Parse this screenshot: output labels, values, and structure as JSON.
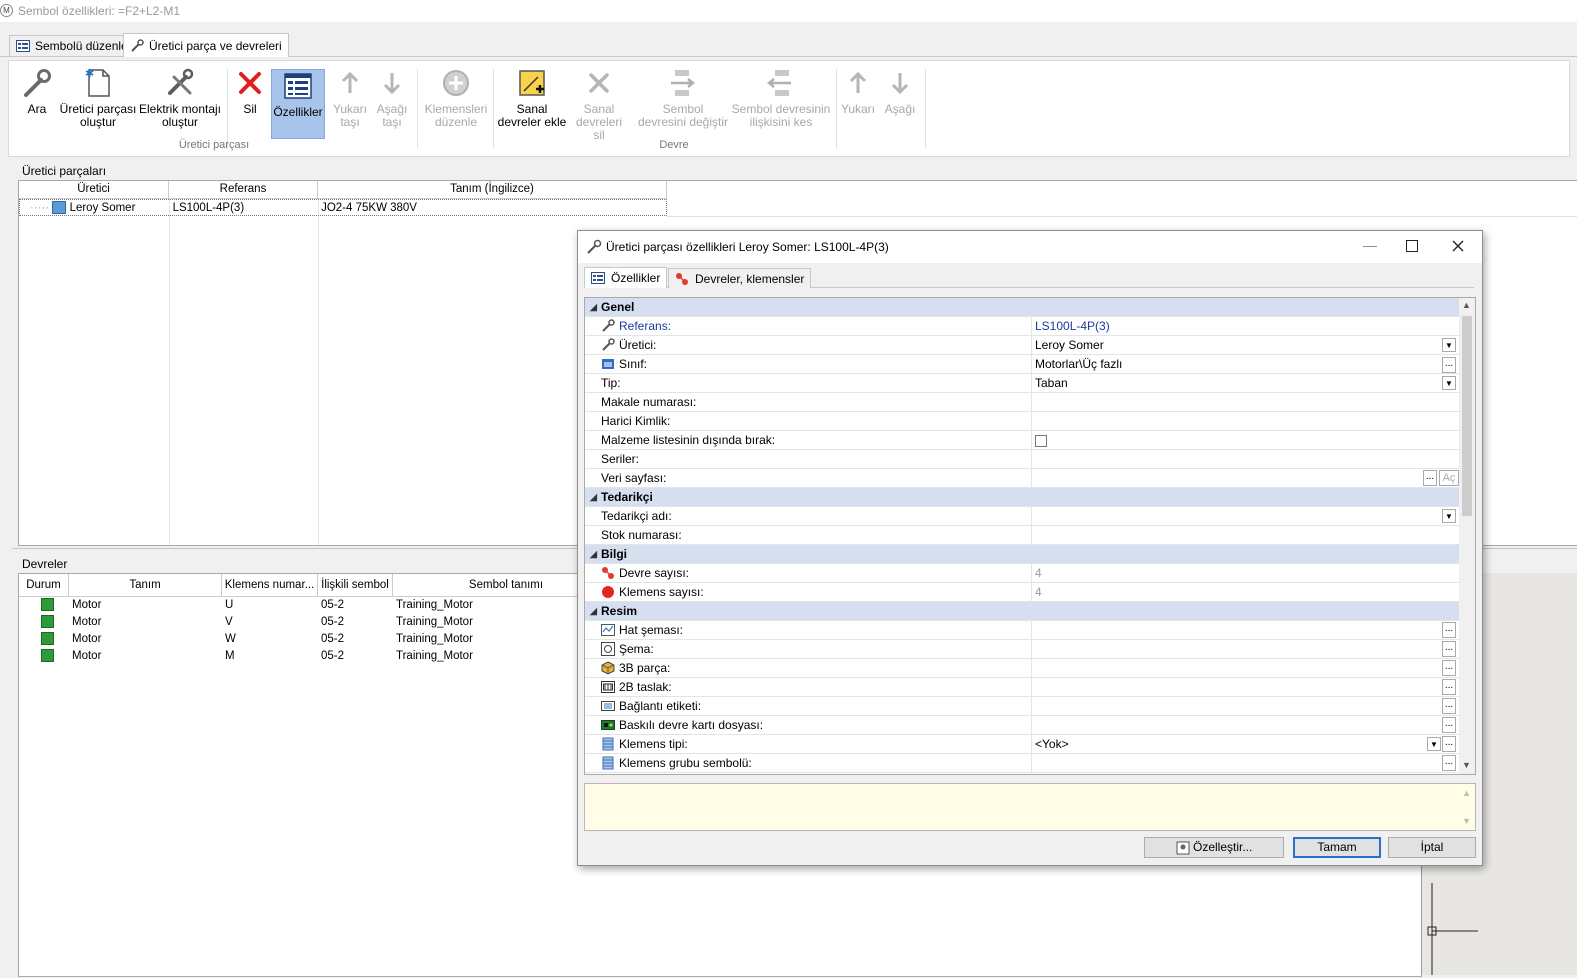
{
  "window": {
    "title": "Sembol özellikleri: =F2+L2-M1"
  },
  "tabs": [
    {
      "label": "Sembolü düzenle"
    },
    {
      "label": "Üretici parça ve devreleri"
    }
  ],
  "ribbon": {
    "ara": "Ara",
    "uretici_olustur": "Üretici parçası oluştur",
    "elektrik_olustur": "Elektrik montajı oluştur",
    "sil": "Sil",
    "ozellikler": "Özellikler",
    "yukari_tasi": "Yukarı taşı",
    "asagi_tasi": "Aşağı taşı",
    "group1": "Üretici parçası",
    "klemens_duzenle": "Klemensleri düzenle",
    "sanal_ekle": "Sanal devreler ekle",
    "sanal_sil": "Sanal devreleri sil",
    "sembol_degistir": "Sembol devresini değiştir",
    "sembol_kes": "Sembol devresinin ilişkisini kes",
    "yukari": "Yukarı",
    "asagi": "Aşağı",
    "group2": "Devre"
  },
  "mfr_section": {
    "title": "Üretici parçaları",
    "columns": [
      "Üretici",
      "Referans",
      "Tanım (İngilizce)"
    ],
    "rows": [
      {
        "uretici": "Leroy Somer",
        "referans": "LS100L-4P(3)",
        "tanim": "JO2-4  75KW  380V"
      }
    ]
  },
  "circuits_section": {
    "title": "Devreler",
    "columns": [
      "Durum",
      "Tanım",
      "Klemens numar...",
      "İlişkili sembol",
      "Sembol tanımı"
    ],
    "rows": [
      {
        "tanim": "Motor",
        "klemens": "U",
        "iliskili": "05-2",
        "sembol": "Training_Motor"
      },
      {
        "tanim": "Motor",
        "klemens": "V",
        "iliskili": "05-2",
        "sembol": "Training_Motor"
      },
      {
        "tanim": "Motor",
        "klemens": "W",
        "iliskili": "05-2",
        "sembol": "Training_Motor"
      },
      {
        "tanim": "Motor",
        "klemens": "M",
        "iliskili": "05-2",
        "sembol": "Training_Motor"
      }
    ]
  },
  "dialog": {
    "title": "Üretici parçası özellikleri Leroy Somer: LS100L-4P(3)",
    "tab1": "Özellikler",
    "tab2": "Devreler, klemensler",
    "cat_genel": "Genel",
    "cat_tedarikci": "Tedarikçi",
    "cat_bilgi": "Bilgi",
    "cat_resim": "Resim",
    "props": {
      "referans_lab": "Referans:",
      "referans_val": "LS100L-4P(3)",
      "uretici_lab": "Üretici:",
      "uretici_val": "Leroy Somer",
      "sinif_lab": "Sınıf:",
      "sinif_val": "Motorlar\\Üç fazlı",
      "tip_lab": "Tip:",
      "tip_val": "Taban",
      "makale_lab": "Makale numarası:",
      "harici_lab": "Harici Kimlik:",
      "malzeme_lab": "Malzeme listesinin dışında bırak:",
      "seriler_lab": "Seriler:",
      "veri_lab": "Veri sayfası:",
      "ac": "Aç",
      "tedarikci_adi_lab": "Tedarikçi adı:",
      "stok_lab": "Stok numarası:",
      "devre_sayisi_lab": "Devre sayısı:",
      "devre_sayisi_val": "4",
      "klemens_sayisi_lab": "Klemens sayısı:",
      "klemens_sayisi_val": "4",
      "hat_lab": "Hat şeması:",
      "sema_lab": "Şema:",
      "parca3b_lab": "3B parça:",
      "taslak2b_lab": "2B taslak:",
      "baglanti_lab": "Bağlantı etiketi:",
      "baskili_lab": "Baskılı devre kartı dosyası:",
      "klemens_tipi_lab": "Klemens tipi:",
      "klemens_tipi_val": "<Yok>",
      "klemens_grubu_lab": "Klemens grubu sembolü:"
    },
    "btn_ozellestir": "Özelleştir...",
    "btn_tamam": "Tamam",
    "btn_iptal": "İptal"
  }
}
